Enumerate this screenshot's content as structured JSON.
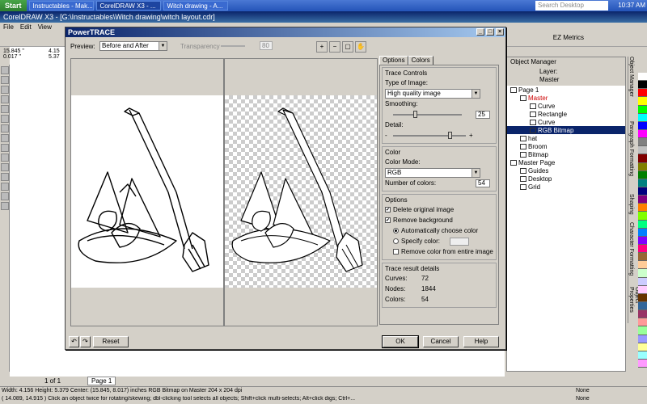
{
  "taskbar": {
    "start": "Start",
    "tasks": [
      "Instructables - Mak...",
      "CorelDRAW X3 - ...",
      "Witch drawing - A..."
    ],
    "active_task": 1,
    "search_placeholder": "Search Desktop",
    "clock": "10:37 AM"
  },
  "app": {
    "title": "CorelDRAW X3 - [G:\\Instructables\\Witch drawing\\witch layout.cdr]",
    "menu": [
      "File",
      "Edit",
      "View"
    ],
    "ez_metrics": "EZ Metrics"
  },
  "dialog": {
    "title": "PowerTRACE",
    "preview_label": "Preview:",
    "preview_value": "Before and After",
    "transparency_label": "Transparency",
    "transparency_value": "80",
    "tabs": [
      "Options",
      "Colors"
    ],
    "trace_controls": {
      "title": "Trace Controls",
      "type_label": "Type of Image:",
      "type_value": "High quality image",
      "smoothing_label": "Smoothing:",
      "smoothing_value": "25",
      "detail_label": "Detail:",
      "detail_minus": "-",
      "detail_plus": "+"
    },
    "color": {
      "title": "Color",
      "mode_label": "Color Mode:",
      "mode_value": "RGB",
      "num_label": "Number of colors:",
      "num_value": "54"
    },
    "options": {
      "title": "Options",
      "delete_original": "Delete original image",
      "remove_background": "Remove background",
      "auto_choose": "Automatically choose color",
      "specify_color": "Specify color:",
      "remove_entire": "Remove color from entire image"
    },
    "details": {
      "title": "Trace result details",
      "curves_label": "Curves:",
      "curves_value": "72",
      "nodes_label": "Nodes:",
      "nodes_value": "1844",
      "colors_label": "Colors:",
      "colors_value": "54"
    },
    "buttons": {
      "reset": "Reset",
      "ok": "OK",
      "cancel": "Cancel",
      "help": "Help"
    }
  },
  "object_manager": {
    "title": "Object Manager",
    "layer_label": "Layer:",
    "layer_value": "Master",
    "tree": [
      {
        "label": "Page 1",
        "indent": 0
      },
      {
        "label": "Master",
        "indent": 1,
        "red": true
      },
      {
        "label": "Curve",
        "indent": 2
      },
      {
        "label": "Rectangle",
        "indent": 2
      },
      {
        "label": "Curve",
        "indent": 2
      },
      {
        "label": "RGB Bitmap",
        "indent": 2,
        "selected": true
      },
      {
        "label": "hat",
        "indent": 1
      },
      {
        "label": "Broom",
        "indent": 1
      },
      {
        "label": "Bitmap",
        "indent": 1
      },
      {
        "label": "Master Page",
        "indent": 0
      },
      {
        "label": "Guides",
        "indent": 1
      },
      {
        "label": "Desktop",
        "indent": 1
      },
      {
        "label": "Grid",
        "indent": 1
      }
    ]
  },
  "dock_tabs": [
    "Object Manager",
    "Paragraph Formatting",
    "Shaping",
    "Character Formatting",
    "Object Properties"
  ],
  "pagebar": {
    "counter": "1 of 1",
    "tab": "Page 1"
  },
  "status": {
    "line1": "Width: 4.156  Height: 5.379  Center: (15.845, 8.017)  inches      RGB Bitmap on Master 204 x 204 dpi",
    "line2": "( 14.089, 14.915 )   Click an object twice for rotating/skewing; dbl-clicking tool selects all objects; Shift+click multi-selects; Alt+click digs; Ctrl+...",
    "fill": "None",
    "outline": "None"
  },
  "coords": {
    "x": "15.845 \"",
    "y": "0.017 \"",
    "w": "4.15",
    "h": "5.37"
  },
  "palette": [
    "#ffffff",
    "#000000",
    "#ff0000",
    "#ffff00",
    "#00ff00",
    "#00ffff",
    "#0000ff",
    "#ff00ff",
    "#808080",
    "#c0c0c0",
    "#800000",
    "#808000",
    "#008000",
    "#008080",
    "#000080",
    "#800080",
    "#ff8000",
    "#80ff00",
    "#00ff80",
    "#0080ff",
    "#8000ff",
    "#ff0080",
    "#996633",
    "#ffcc99",
    "#ccffcc",
    "#ccccff",
    "#ffccff",
    "#663300",
    "#336699",
    "#993366",
    "#ff9999",
    "#99ff99",
    "#9999ff",
    "#ffff99",
    "#99ffff",
    "#ff99ff"
  ]
}
